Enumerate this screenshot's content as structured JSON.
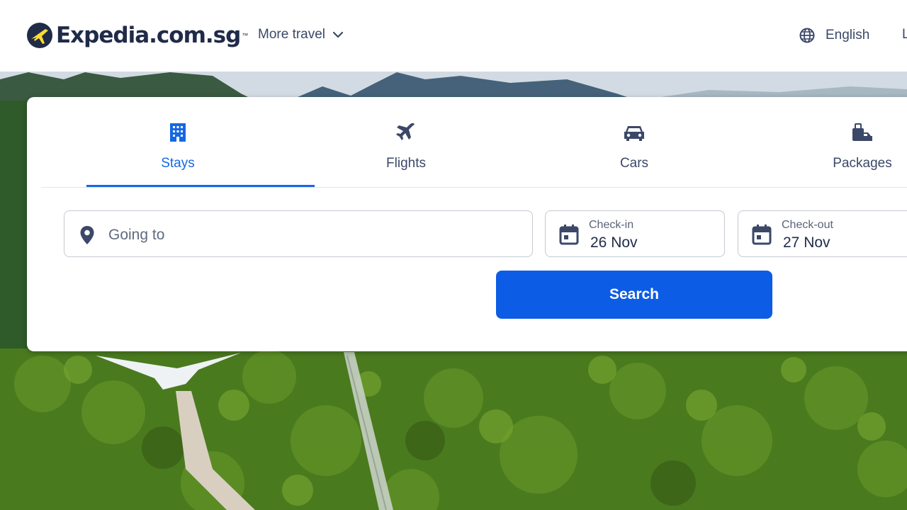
{
  "header": {
    "logo_text": "Expedia.com.sg",
    "logo_tm": "™",
    "more_travel": "More travel",
    "language": "English",
    "edge_letter": "L"
  },
  "tabs": [
    {
      "label": "Stays",
      "icon": "building-icon",
      "active": true
    },
    {
      "label": "Flights",
      "icon": "airplane-icon",
      "active": false
    },
    {
      "label": "Cars",
      "icon": "car-icon",
      "active": false
    },
    {
      "label": "Packages",
      "icon": "packages-icon",
      "active": false
    }
  ],
  "search": {
    "going_to_placeholder": "Going to",
    "checkin_label": "Check-in",
    "checkin_value": "26 Nov",
    "checkout_label": "Check-out",
    "checkout_value": "27 Nov",
    "button_label": "Search"
  },
  "colors": {
    "brand_navy": "#1f2b48",
    "active_blue": "#1668e3",
    "search_button": "#0c5ce6",
    "logo_yellow": "#fddb32"
  }
}
